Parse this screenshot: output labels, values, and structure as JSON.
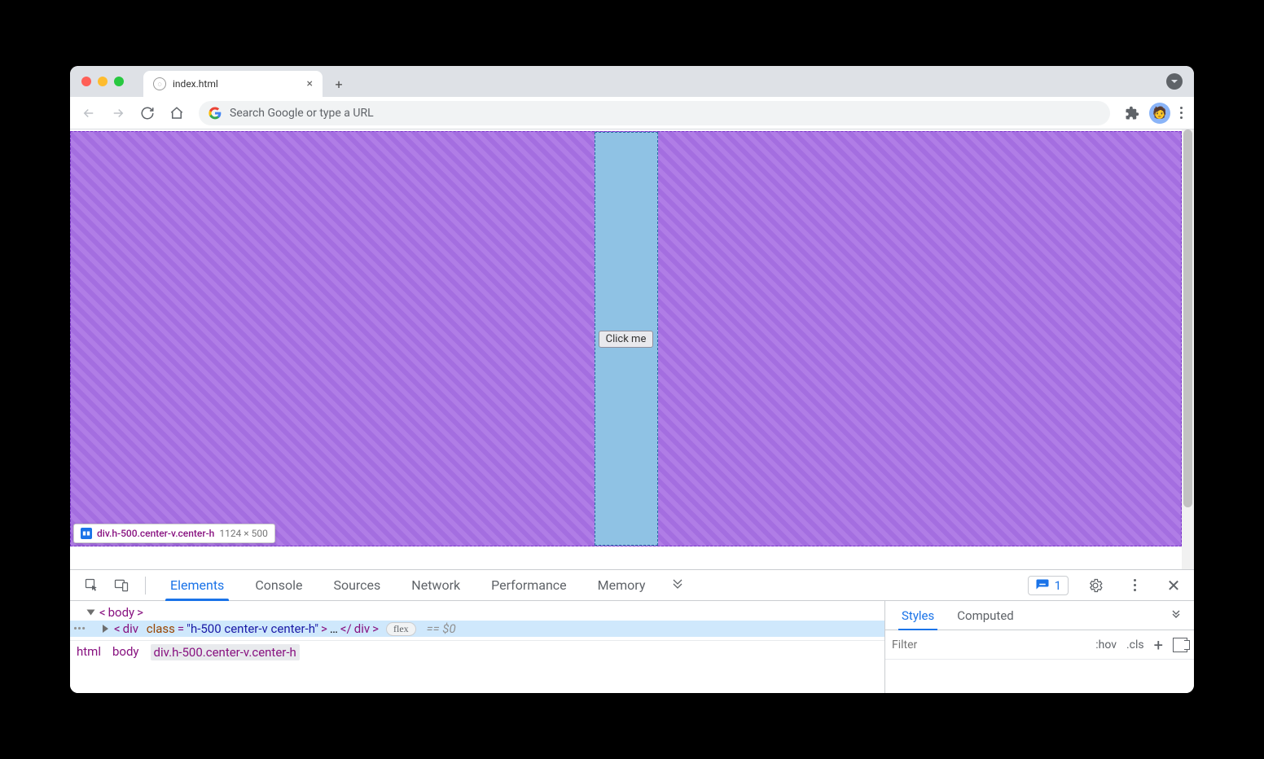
{
  "browser": {
    "tab_title": "index.html",
    "omnibox_placeholder": "Search Google or type a URL"
  },
  "page": {
    "button_label": "Click me",
    "highlight_selector": "div.h-500.center-v.center-h",
    "highlight_dims": "1124 × 500"
  },
  "devtools": {
    "tabs": [
      "Elements",
      "Console",
      "Sources",
      "Network",
      "Performance",
      "Memory"
    ],
    "active_tab": "Elements",
    "issues_count": "1",
    "tree": {
      "body_open": "body",
      "sel_tag": "div",
      "sel_attr_name": "class",
      "sel_attr_value": "h-500 center-v center-h",
      "ellipsis": "…",
      "close_tag": "div",
      "flex_badge": "flex",
      "eq": "== $0"
    },
    "breadcrumbs": [
      "html",
      "body",
      "div.h-500.center-v.center-h"
    ],
    "styles": {
      "tabs": [
        "Styles",
        "Computed"
      ],
      "active": "Styles",
      "filter_placeholder": "Filter",
      "hov": ":hov",
      "cls": ".cls"
    }
  }
}
